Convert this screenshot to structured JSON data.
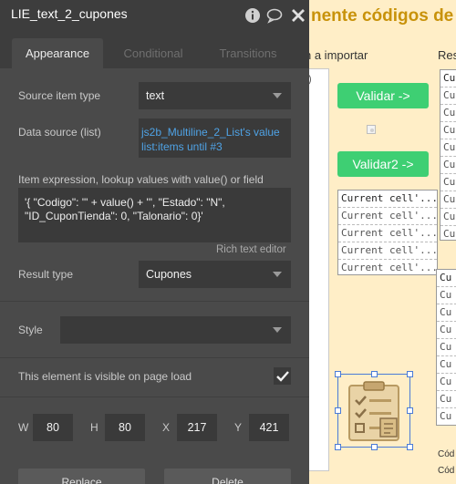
{
  "panel": {
    "title": "LIE_text_2_cupones",
    "tabs": [
      {
        "label": "Appearance",
        "active": true
      },
      {
        "label": "Conditional",
        "active": false
      },
      {
        "label": "Transitions",
        "active": false
      }
    ],
    "source_item_type": {
      "label": "Source item type",
      "value": "text"
    },
    "data_source": {
      "label": "Data source (list)",
      "line1": "js2b_Multiline_2_List's value",
      "line2": "list:items until #3"
    },
    "item_expression": {
      "label": "Item expression, lookup values with value() or field",
      "line1": "'{ \"Codigo\": \"' + value() + '\", \"Estado\": \"N\",",
      "line2": "\"ID_CuponTienda\": 0, \"Talonario\": 0}'",
      "rich_text_link": "Rich text editor"
    },
    "result_type": {
      "label": "Result type",
      "value": "Cupones"
    },
    "style": {
      "label": "Style",
      "value": ""
    },
    "visible_on_load": {
      "label": "This element is visible on page load",
      "checked": true
    },
    "geometry": [
      {
        "label": "W",
        "value": "80"
      },
      {
        "label": "H",
        "value": "80"
      },
      {
        "label": "X",
        "value": "217"
      },
      {
        "label": "Y",
        "value": "421"
      }
    ],
    "buttons": {
      "replace": "Replace",
      "delete": "Delete"
    },
    "icons": {
      "info": "info-icon",
      "comment": "comment-icon",
      "close": "close-icon"
    }
  },
  "canvas": {
    "title": "nente códigos de",
    "heading_left": "n a importar",
    "heading_right": "Res",
    "panel_text": ")",
    "btn_validar": "Validar ->",
    "btn_validar2": "Validar2 ->",
    "list_a": [
      "Current cell'...",
      "Current cell'...",
      "Current cell'...",
      "Current cell'...",
      "Current cell'..."
    ],
    "list_r1": [
      "Cu",
      "Cu",
      "Cu",
      "Cu",
      "Cu",
      "Cu",
      "Cu",
      "Cu",
      "Cu",
      "Cu"
    ],
    "list_r2": [
      "Cu",
      "Cu",
      "Cu",
      "Cu",
      "Cu",
      "Cu",
      "Cu",
      "Cu",
      "Cu",
      "Cu"
    ],
    "bottom_text_1": "Cód",
    "bottom_text_2": "Cód",
    "selected_element_icon": "checklist-icon"
  }
}
